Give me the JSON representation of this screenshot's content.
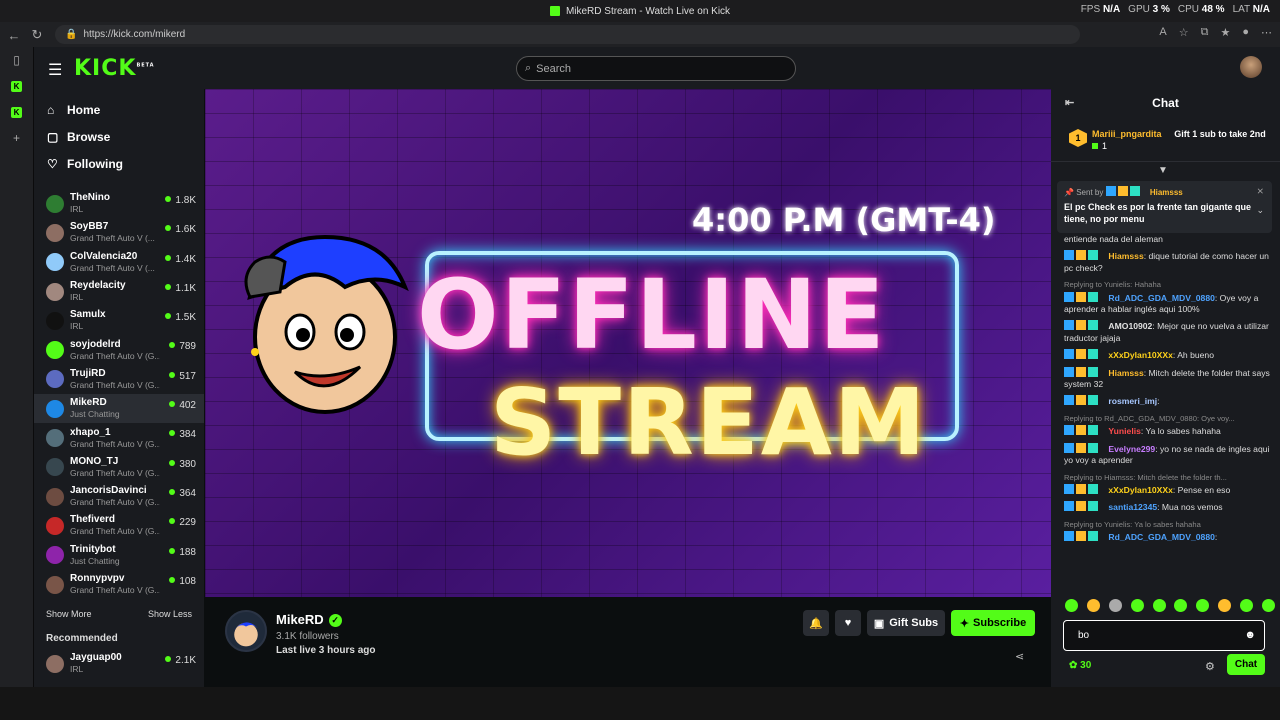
{
  "window": {
    "title": "MikeRD Stream - Watch Live on Kick"
  },
  "perf": {
    "fps_label": "FPS",
    "fps": "N/A",
    "gpu_label": "GPU",
    "gpu": "3 %",
    "cpu_label": "CPU",
    "cpu": "48 %",
    "lat_label": "LAT",
    "lat": "N/A"
  },
  "address": {
    "url": "https://kick.com/mikerd"
  },
  "topnav": {
    "logo": "KICK",
    "logo_beta": "BETA",
    "search_placeholder": "Search"
  },
  "sidebar": {
    "nav": [
      {
        "label": "Home"
      },
      {
        "label": "Browse"
      },
      {
        "label": "Following"
      }
    ],
    "channels": [
      {
        "name": "TheNino",
        "category": "IRL",
        "viewers": "1.8K",
        "color": "#2e7d32"
      },
      {
        "name": "SoyBB7",
        "category": "Grand Theft Auto V (...",
        "viewers": "1.6K",
        "color": "#8d6e63"
      },
      {
        "name": "ColValencia20",
        "category": "Grand Theft Auto V (...",
        "viewers": "1.4K",
        "color": "#90caf9"
      },
      {
        "name": "Reydelacity",
        "category": "IRL",
        "viewers": "1.1K",
        "color": "#a1887f"
      },
      {
        "name": "Samulx",
        "category": "IRL",
        "viewers": "1.5K",
        "color": "#111111"
      },
      {
        "name": "soyjodelrd",
        "category": "Grand Theft Auto V (G...",
        "viewers": "789",
        "color": "#53fc18"
      },
      {
        "name": "TrujiRD",
        "category": "Grand Theft Auto V (G...",
        "viewers": "517",
        "color": "#5c6bc0"
      },
      {
        "name": "MikeRD",
        "category": "Just Chatting",
        "viewers": "402",
        "color": "#1e88e5"
      },
      {
        "name": "xhapo_1",
        "category": "Grand Theft Auto V (G...",
        "viewers": "384",
        "color": "#546e7a"
      },
      {
        "name": "MONO_TJ",
        "category": "Grand Theft Auto V (G...",
        "viewers": "380",
        "color": "#37474f"
      },
      {
        "name": "JancorisDavinci",
        "category": "Grand Theft Auto V (G...",
        "viewers": "364",
        "color": "#6d4c41"
      },
      {
        "name": "Thefiverd",
        "category": "Grand Theft Auto V (G...",
        "viewers": "229",
        "color": "#c62828"
      },
      {
        "name": "Trinitybot",
        "category": "Just Chatting",
        "viewers": "188",
        "color": "#8e24aa"
      },
      {
        "name": "Ronnypvpv",
        "category": "Grand Theft Auto V (G...",
        "viewers": "108",
        "color": "#795548"
      }
    ],
    "show_more": "Show More",
    "show_less": "Show Less",
    "recommended": "Recommended",
    "rec_channel": {
      "name": "Jayguap00",
      "category": "IRL",
      "viewers": "2.1K"
    }
  },
  "stream": {
    "time_text": "4:00 P.M (GMT-4)",
    "line1": "OFFLINE",
    "line2": "STREAM"
  },
  "channel": {
    "name": "MikeRD",
    "followers": "3.1K followers",
    "last_live": "Last live 3 hours ago",
    "gift_label": "Gift Subs",
    "subscribe_label": "Subscribe"
  },
  "chat": {
    "title": "Chat",
    "gift": {
      "user": "Mariii_pngardita",
      "count": "1",
      "take": "Gift 1 sub to take 2nd"
    },
    "pinned": {
      "sent_by": "Sent by",
      "user": "Hiamsss",
      "message": "El pc Check es por la frente tan gigante que tiene, no por menu"
    },
    "messages": [
      {
        "reply": "",
        "user": "",
        "color": "#ddd",
        "text": "entiende nada del aleman"
      },
      {
        "reply": "",
        "user": "Hiamsss",
        "color": "#ffbd2e",
        "text": ": dique tutorial de como hacer un pc check?"
      },
      {
        "reply": "Replying to Yunielis: Hahaha",
        "user": "Rd_ADC_GDA_MDV_0880",
        "color": "#4ea3ff",
        "text": ": Oye voy a aprender a hablar inglés aqui 100%"
      },
      {
        "reply": "",
        "user": "AMO10902",
        "color": "#e0e0e0",
        "text": ": Mejor que no vuelva a utilizar traductor jajaja"
      },
      {
        "reply": "",
        "user": "xXxDylan10XXx",
        "color": "#ffd21a",
        "text": ": Ah bueno"
      },
      {
        "reply": "",
        "user": "Hiamsss",
        "color": "#ffbd2e",
        "text": ": Mitch delete the folder that says system 32"
      },
      {
        "reply": "",
        "user": "rosmeri_imj",
        "color": "#a7c7ff",
        "text": ":"
      },
      {
        "reply": "Replying to Rd_ADC_GDA_MDV_0880: Oye voy...",
        "user": "Yunielis",
        "color": "#ff4d4d",
        "text": ": Ya lo sabes hahaha"
      },
      {
        "reply": "",
        "user": "Evelyne299",
        "color": "#c77dff",
        "text": ": yo no se nada de ingles aqui yo voy a aprender"
      },
      {
        "reply": "Replying to Hiamsss: Mitch delete the folder th...",
        "user": "xXxDylan10XXx",
        "color": "#ffd21a",
        "text": ": Pense en eso"
      },
      {
        "reply": "",
        "user": "santia12345",
        "color": "#4ea3ff",
        "text": ": Mua nos vemos"
      },
      {
        "reply": "Replying to Yunielis: Ya lo sabes hahaha",
        "user": "Rd_ADC_GDA_MDV_0880",
        "color": "#4ea3ff",
        "text": ":"
      }
    ],
    "input_value": "bo",
    "points": "30",
    "send_label": "Chat"
  },
  "colors": {
    "accent": "#53fc18",
    "bg": "#0b0e0f",
    "panel": "#191b1f"
  }
}
